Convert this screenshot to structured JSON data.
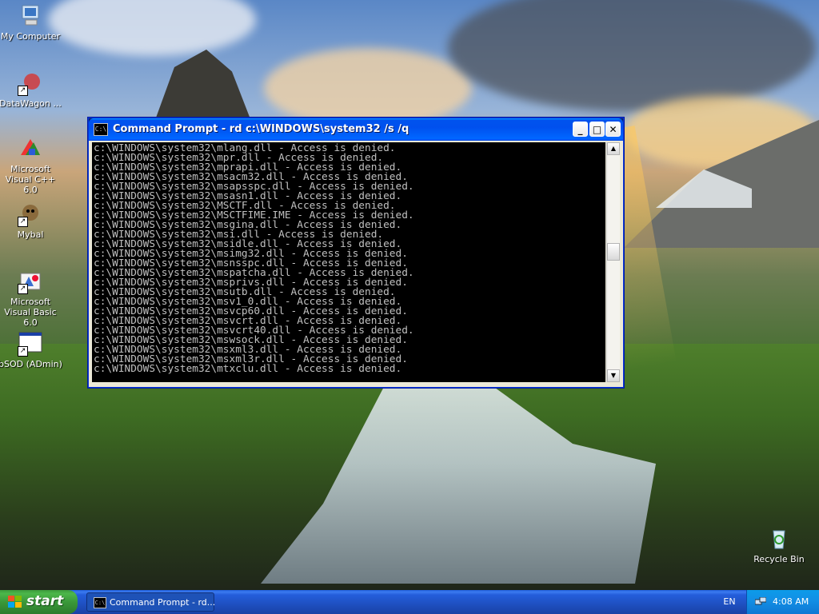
{
  "desktop": {
    "icons": [
      {
        "label": "My Computer",
        "icon": "computer-icon"
      },
      {
        "label": "DataWagon ...",
        "icon": "datawagon-shortcut-icon"
      },
      {
        "label": "Microsoft Visual C++ 6.0",
        "icon": "visual-cpp-icon"
      },
      {
        "label": "Mybal",
        "icon": "mybal-shortcut-icon"
      },
      {
        "label": "Microsoft Visual Basic 6.0",
        "icon": "visual-basic-icon"
      },
      {
        "label": "bSOD (ADmin)",
        "icon": "bsod-shortcut-icon"
      },
      {
        "label": "Recycle Bin",
        "icon": "recycle-bin-icon"
      }
    ]
  },
  "window": {
    "app_icon_text": "C:\\",
    "title": "Command Prompt - rd c:\\WINDOWS\\system32 /s /q",
    "buttons": {
      "minimize": "_",
      "maximize": "□",
      "close": "✕"
    },
    "console_lines": [
      "c:\\WINDOWS\\system32\\mlang.dll - Access is denied.",
      "c:\\WINDOWS\\system32\\mpr.dll - Access is denied.",
      "c:\\WINDOWS\\system32\\mprapi.dll - Access is denied.",
      "c:\\WINDOWS\\system32\\msacm32.dll - Access is denied.",
      "c:\\WINDOWS\\system32\\msapsspc.dll - Access is denied.",
      "c:\\WINDOWS\\system32\\msasn1.dll - Access is denied.",
      "c:\\WINDOWS\\system32\\MSCTF.dll - Access is denied.",
      "c:\\WINDOWS\\system32\\MSCTFIME.IME - Access is denied.",
      "c:\\WINDOWS\\system32\\msgina.dll - Access is denied.",
      "c:\\WINDOWS\\system32\\msi.dll - Access is denied.",
      "c:\\WINDOWS\\system32\\msidle.dll - Access is denied.",
      "c:\\WINDOWS\\system32\\msimg32.dll - Access is denied.",
      "c:\\WINDOWS\\system32\\msnsspc.dll - Access is denied.",
      "c:\\WINDOWS\\system32\\mspatcha.dll - Access is denied.",
      "c:\\WINDOWS\\system32\\msprivs.dll - Access is denied.",
      "c:\\WINDOWS\\system32\\msutb.dll - Access is denied.",
      "c:\\WINDOWS\\system32\\msv1_0.dll - Access is denied.",
      "c:\\WINDOWS\\system32\\msvcp60.dll - Access is denied.",
      "c:\\WINDOWS\\system32\\msvcrt.dll - Access is denied.",
      "c:\\WINDOWS\\system32\\msvcrt40.dll - Access is denied.",
      "c:\\WINDOWS\\system32\\mswsock.dll - Access is denied.",
      "c:\\WINDOWS\\system32\\msxml3.dll - Access is denied.",
      "c:\\WINDOWS\\system32\\msxml3r.dll - Access is denied.",
      "c:\\WINDOWS\\system32\\mtxclu.dll - Access is denied."
    ]
  },
  "taskbar": {
    "start_label": "start",
    "task_label": "Command Prompt - rd...",
    "task_icon_text": "C:\\",
    "language": "EN",
    "clock": "4:08 AM"
  },
  "colors": {
    "console_bg": "#000000",
    "console_text": "#c0c0c0",
    "titlebar": "#0053ee",
    "start_green": "#3a983a",
    "taskbar_blue": "#245edb"
  }
}
